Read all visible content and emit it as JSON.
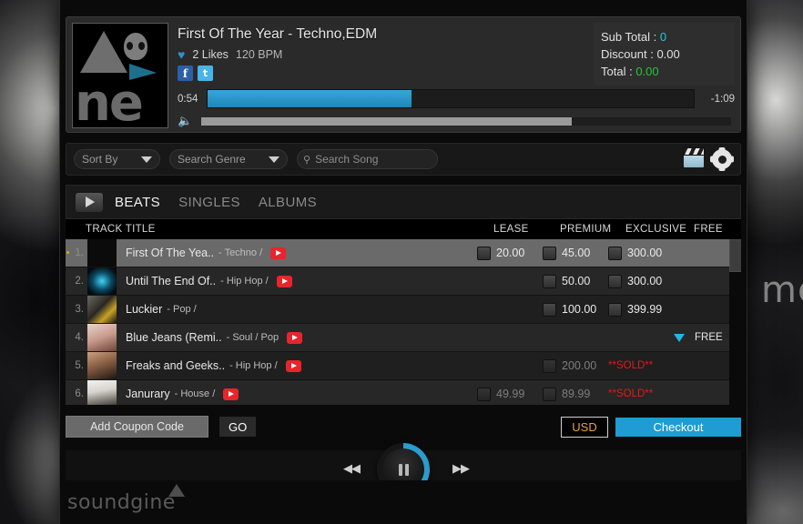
{
  "background": {
    "right_word": "me"
  },
  "now_playing": {
    "title": "First Of The Year - Techno,EDM",
    "likes": "2 Likes",
    "bpm": "120 BPM",
    "heart_icon": "heart-icon",
    "social": [
      {
        "name": "facebook-icon",
        "glyph": "f"
      },
      {
        "name": "twitter-icon",
        "glyph": "t"
      }
    ],
    "time_current": "0:54",
    "time_remaining": "-1:09",
    "seek_percent": 42,
    "volume_percent": 70,
    "artwork_label": "ne"
  },
  "totals": {
    "sub_total_label": "Sub Total  :",
    "sub_total_value": "0",
    "discount_label": "Discount :",
    "discount_value": "0.00",
    "total_label": "Total :",
    "total_value": "0.00"
  },
  "toolbar": {
    "sort_by": "Sort By",
    "search_genre": "Search Genre",
    "search_song_placeholder": "Search Song",
    "search_song_value": "",
    "video_icon": "clapperboard-icon",
    "settings_icon": "gear-icon"
  },
  "tabs": {
    "play_icon": "play-icon",
    "items": [
      {
        "label": "BEATS",
        "active": true
      },
      {
        "label": "SINGLES",
        "active": false
      },
      {
        "label": "ALBUMS",
        "active": false
      }
    ]
  },
  "table": {
    "columns": {
      "track_title": "TRACK TITLE",
      "lease": "LEASE",
      "premium": "PREMIUM",
      "exclusive": "EXCLUSIVE",
      "free": "FREE"
    },
    "rows": [
      {
        "num": "1.",
        "title": "First Of The Yea..",
        "genre": "- Techno /",
        "youtube": true,
        "selected": true,
        "lease": "20.00",
        "premium": "45.00",
        "exclusive": "300.00",
        "free": "",
        "sold": false
      },
      {
        "num": "2.",
        "title": "Until The End Of..",
        "genre": "- Hip Hop /",
        "youtube": true,
        "selected": false,
        "lease": "",
        "premium": "50.00",
        "exclusive": "300.00",
        "free": "",
        "sold": false
      },
      {
        "num": "3.",
        "title": "Luckier",
        "genre": "- Pop /",
        "youtube": false,
        "selected": false,
        "lease": "",
        "premium": "100.00",
        "exclusive": "399.99",
        "free": "",
        "sold": false
      },
      {
        "num": "4.",
        "title": "Blue Jeans (Remi..",
        "genre": "- Soul / Pop",
        "youtube": true,
        "selected": false,
        "lease": "",
        "premium": "",
        "exclusive": "",
        "free": "FREE",
        "sold": false
      },
      {
        "num": "5.",
        "title": "Freaks and Geeks..",
        "genre": "- Hip Hop /",
        "youtube": true,
        "selected": false,
        "lease": "",
        "premium": "200.00",
        "exclusive": "",
        "free": "",
        "sold": true,
        "sold_label": "**SOLD**"
      },
      {
        "num": "6.",
        "title": "Janurary",
        "genre": "- House /",
        "youtube": true,
        "selected": false,
        "lease": "49.99",
        "premium": "89.99",
        "exclusive": "",
        "free": "",
        "sold": true,
        "sold_label": "**SOLD**"
      }
    ]
  },
  "checkout_bar": {
    "coupon_placeholder": "Add Coupon Code",
    "go_label": "GO",
    "currency": "USD",
    "checkout_label": "Checkout"
  },
  "transport": {
    "prev_icon": "rewind-icon",
    "next_icon": "fast-forward-icon",
    "play_state_icon": "pause-icon",
    "ring_percent": 36
  },
  "footer": {
    "brand": "soundgine"
  },
  "colors": {
    "accent_blue": "#1e9cd3",
    "seek_blue": "#2f9bcd",
    "sold_red": "#e01b1b",
    "total_green": "#25c63a",
    "subtotal_cyan": "#26c6da",
    "currency_orange": "#e9a23b",
    "youtube_red": "#e8252a"
  }
}
